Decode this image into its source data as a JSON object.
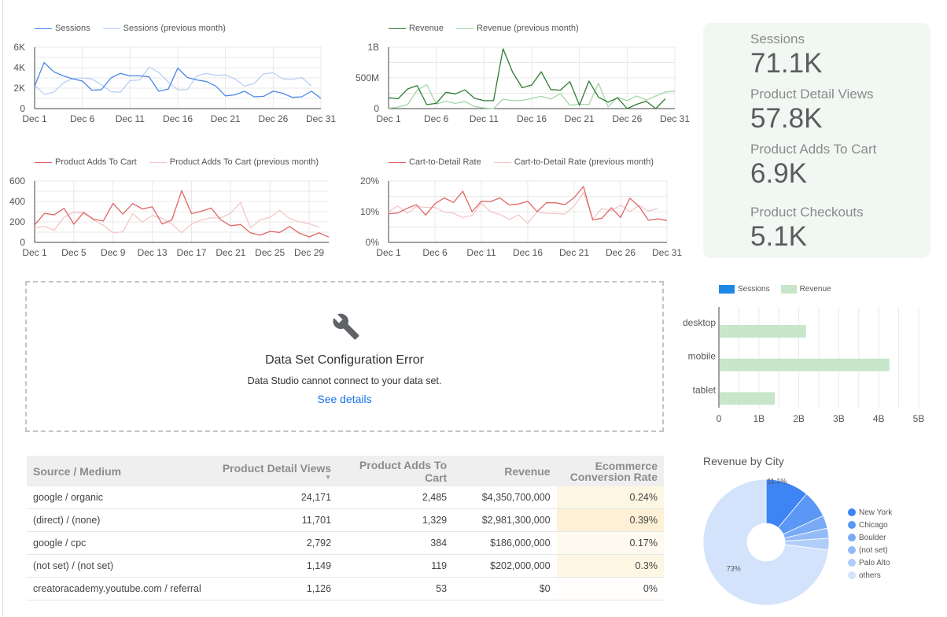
{
  "colors": {
    "sessions": "#4a86e8",
    "sessions_prev": "#b8d0f5",
    "revenue": "#2e7d32",
    "revenue_prev": "#a5d6a7",
    "adds": "#e06666",
    "adds_prev": "#f4c7c7",
    "rate": "#e06666",
    "rate_prev": "#f4c7c7",
    "bar_sessions": "#1e88e5",
    "bar_revenue": "#c8e6c9",
    "link": "#1a73e8",
    "conv_highlight_1": "#fdf6e3",
    "conv_highlight_2": "#fdf0d5",
    "conv_highlight_3": "#fefaef",
    "conv_highlight_4": "#fdf6e3",
    "conv_highlight_5": "#fffefc"
  },
  "chart_data": [
    {
      "id": "sessions",
      "type": "line",
      "title": "",
      "legend": [
        "Sessions",
        "Sessions (previous month)"
      ],
      "legend_position": "top-left",
      "x_ticks": [
        "Dec 1",
        "Dec 6",
        "Dec 11",
        "Dec 16",
        "Dec 21",
        "Dec 26",
        "Dec 31"
      ],
      "y_ticks": [
        "0",
        "2K",
        "4K",
        "6K"
      ],
      "ylim": [
        0,
        6000
      ],
      "days": 31,
      "series": [
        {
          "name": "Sessions",
          "values": [
            2200,
            4500,
            3600,
            3200,
            2900,
            2700,
            1800,
            1850,
            3000,
            3450,
            3200,
            3200,
            3100,
            1700,
            1900,
            3950,
            3050,
            2800,
            2650,
            2200,
            1250,
            1350,
            1700,
            1150,
            1200,
            1700,
            1500,
            1100,
            1150,
            1700,
            1000
          ]
        },
        {
          "name": "Sessions (previous month)",
          "values": [
            2300,
            1400,
            1600,
            2500,
            2950,
            3000,
            2900,
            2350,
            1650,
            1600,
            2750,
            2800,
            4050,
            3550,
            2600,
            1850,
            1850,
            3200,
            3450,
            3250,
            3300,
            2900,
            2200,
            2450,
            3400,
            3500,
            2900,
            2850,
            3050,
            2200
          ]
        }
      ]
    },
    {
      "id": "revenue",
      "type": "line",
      "title": "",
      "legend": [
        "Revenue",
        "Revenue (previous month)"
      ],
      "legend_position": "top-left",
      "x_ticks": [
        "Dec 1",
        "Dec 6",
        "Dec 11",
        "Dec 16",
        "Dec 21",
        "Dec 26",
        "Dec 31"
      ],
      "y_ticks": [
        "0",
        "500M",
        "1B"
      ],
      "ylim": [
        0,
        1000000000
      ],
      "days": 31,
      "series": [
        {
          "name": "Revenue",
          "values": [
            175000000,
            160000000,
            320000000,
            375000000,
            65000000,
            85000000,
            265000000,
            240000000,
            305000000,
            170000000,
            130000000,
            130000000,
            975000000,
            595000000,
            340000000,
            385000000,
            600000000,
            310000000,
            300000000,
            440000000,
            55000000,
            450000000,
            185000000,
            105000000,
            175000000,
            0,
            70000000,
            120000000,
            0,
            160000000
          ]
        },
        {
          "name": "Revenue (previous month)",
          "values": [
            5000000,
            25000000,
            65000000,
            300000000,
            390000000,
            75000000,
            120000000,
            85000000,
            115000000,
            35000000,
            10000000,
            0,
            155000000,
            130000000,
            135000000,
            165000000,
            200000000,
            155000000,
            245000000,
            55000000,
            70000000,
            65000000,
            415000000,
            30000000,
            185000000,
            130000000,
            205000000,
            140000000,
            205000000,
            270000000,
            285000000
          ]
        }
      ]
    },
    {
      "id": "adds",
      "type": "line",
      "title": "",
      "legend": [
        "Product Adds To Cart",
        "Product Adds To Cart (previous month)"
      ],
      "legend_position": "top-left",
      "x_ticks": [
        "Dec 1",
        "Dec 5",
        "Dec 9",
        "Dec 13",
        "Dec 17",
        "Dec 21",
        "Dec 25",
        "Dec 29"
      ],
      "y_ticks": [
        "0",
        "200",
        "400",
        "600"
      ],
      "ylim": [
        0,
        600
      ],
      "days": 31,
      "series": [
        {
          "name": "Product Adds To Cart",
          "values": [
            170,
            283,
            270,
            332,
            178,
            293,
            227,
            209,
            381,
            276,
            379,
            327,
            348,
            180,
            219,
            505,
            281,
            304,
            335,
            219,
            162,
            175,
            95,
            70,
            108,
            98,
            155,
            90,
            54,
            93,
            52
          ]
        },
        {
          "name": "Product Adds To Cart (previous month)",
          "values": [
            144,
            157,
            118,
            247,
            296,
            286,
            219,
            167,
            95,
            103,
            281,
            198,
            265,
            234,
            180,
            95,
            180,
            219,
            240,
            240,
            286,
            389,
            142,
            219,
            245,
            312,
            232,
            201,
            183,
            147
          ]
        }
      ]
    },
    {
      "id": "rate",
      "type": "line",
      "title": "",
      "legend": [
        "Cart-to-Detail Rate",
        "Cart-to-Detail Rate (previous month)"
      ],
      "legend_position": "top-left",
      "x_ticks": [
        "Dec 1",
        "Dec 6",
        "Dec 11",
        "Dec 16",
        "Dec 21",
        "Dec 26",
        "Dec 31"
      ],
      "y_ticks": [
        "0%",
        "10%",
        "20%"
      ],
      "ylim": [
        0,
        20
      ],
      "days": 31,
      "series": [
        {
          "name": "Cart-to-Detail Rate",
          "values": [
            9.3,
            9.6,
            11.1,
            12.3,
            8.9,
            12.6,
            14.5,
            13.0,
            16.7,
            10.0,
            13.4,
            13.3,
            14.5,
            12.2,
            12.5,
            13.4,
            10.0,
            12.9,
            12.9,
            12.3,
            14.6,
            18.2,
            7.3,
            7.9,
            11.3,
            8.1,
            14.4,
            11.7,
            7.2,
            7.7,
            7.1
          ]
        },
        {
          "name": "Cart-to-Detail Rate (previous month)",
          "values": [
            9.9,
            11.9,
            9.5,
            11.7,
            11.4,
            11.4,
            9.9,
            9.5,
            8.1,
            8.8,
            12.8,
            10.0,
            9.1,
            7.5,
            9.0,
            6.2,
            10.0,
            9.5,
            9.4,
            9.2,
            11.9,
            16.3,
            7.7,
            11.1,
            10.3,
            12.2,
            10.0,
            12.0,
            10.2,
            11.0
          ]
        }
      ]
    },
    {
      "id": "device",
      "type": "bar",
      "orientation": "horizontal",
      "title": "",
      "legend": [
        "Sessions",
        "Revenue"
      ],
      "legend_position": "top-left",
      "categories": [
        "desktop",
        "mobile",
        "tablet"
      ],
      "series": [
        {
          "name": "Sessions",
          "values": [
            null,
            null,
            null
          ]
        },
        {
          "name": "Revenue",
          "values": [
            2180000000,
            4270000000,
            1400000000
          ]
        }
      ],
      "x_ticks": [
        "0",
        "1B",
        "2B",
        "3B",
        "4B",
        "5B"
      ],
      "xlim": [
        0,
        5000000000
      ]
    },
    {
      "id": "city",
      "type": "pie",
      "title": "Revenue by City",
      "legend_position": "right",
      "labels": [
        "New York",
        "Chicago",
        "Boulder",
        "(not set)",
        "Palo Alto",
        "others"
      ],
      "values": [
        11.1,
        7.0,
        3.3,
        2.6,
        3.0,
        73.0
      ],
      "slice_labels": [
        "11.1%",
        "",
        "",
        "",
        "",
        "73%"
      ],
      "colors": [
        "#3d85f5",
        "#5b97f5",
        "#79aaf7",
        "#93bbf8",
        "#b1cefa",
        "#d3e3fc"
      ]
    }
  ],
  "scorecard": [
    {
      "label": "Sessions",
      "value": "71.1K"
    },
    {
      "label": "Product Detail Views",
      "value": "57.8K"
    },
    {
      "label": "Product Adds To Cart",
      "value": "6.9K"
    },
    {
      "label": "Product Checkouts",
      "value": "5.1K"
    }
  ],
  "error": {
    "icon": "wrench-icon",
    "title": "Data Set Configuration Error",
    "message": "Data Studio cannot connect to your data set.",
    "link": "See details"
  },
  "table": {
    "headers": [
      "Source / Medium",
      "Product Detail Views",
      "Product Adds To Cart",
      "Revenue",
      "Ecommerce Conversion Rate"
    ],
    "sort_indicator": "▼",
    "rows": [
      [
        "google / organic",
        "24,171",
        "2,485",
        "$4,350,700,000",
        "0.24%"
      ],
      [
        "(direct) / (none)",
        "11,701",
        "1,329",
        "$2,981,300,000",
        "0.39%"
      ],
      [
        "google / cpc",
        "2,792",
        "384",
        "$186,000,000",
        "0.17%"
      ],
      [
        "(not set) / (not set)",
        "1,149",
        "119",
        "$202,000,000",
        "0.3%"
      ],
      [
        "creatoracademy.youtube.com / referral",
        "1,126",
        "53",
        "$0",
        "0%"
      ]
    ]
  }
}
